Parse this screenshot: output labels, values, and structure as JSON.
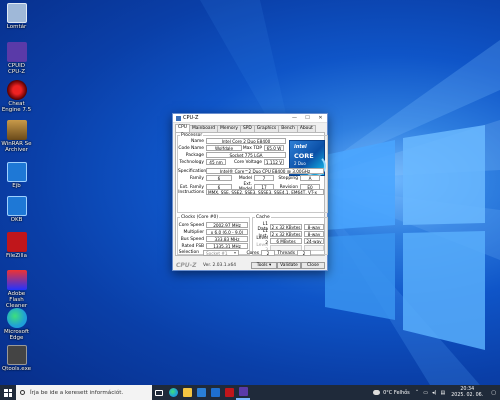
{
  "desktop": {
    "icons": [
      {
        "label": "Lomtár",
        "color": "#9fb8d8"
      },
      {
        "label": "CPUID CPU-Z",
        "color": "#5a3aa8"
      },
      {
        "label": "Cheat Engine 7.5",
        "color": "#c21b1b"
      },
      {
        "label": "WinRAR Se Archiver",
        "color": "#8a6b3a"
      },
      {
        "label": "Ejb",
        "color": "#1e78d6"
      },
      {
        "label": "OKB",
        "color": "#1e78d6"
      },
      {
        "label": "FileZilla",
        "color": "#c0161b"
      },
      {
        "label": "Adobe Flash Cleaner",
        "color": "#2a6fcf"
      },
      {
        "label": "Microsoft Edge",
        "color": "#1fa0d8"
      },
      {
        "label": "Qtools.exe",
        "color": "#444444"
      }
    ]
  },
  "window": {
    "title": "CPU-Z",
    "controls": {
      "minimize": "—",
      "maximize": "☐",
      "close": "✕"
    },
    "tabs": [
      "CPU",
      "Mainboard",
      "Memory",
      "SPD",
      "Graphics",
      "Bench",
      "About"
    ],
    "active_tab": "CPU",
    "processor": {
      "legend": "Processor",
      "name_label": "Name",
      "name": "Intel Core 2 Duo E8400",
      "codename_label": "Code Name",
      "codename": "Wolfdale",
      "maxtdp_label": "Max TDP",
      "maxtdp": "65.0 W",
      "package_label": "Package",
      "package": "Socket 775 LGA",
      "technology_label": "Technology",
      "technology": "45 nm",
      "corevoltage_label": "Core Voltage",
      "corevoltage": "1.112 V",
      "spec_label": "Specification",
      "spec": "Intel® Core™2 Duo CPU   E8400  @ 3.00GHz",
      "family_label": "Family",
      "family": "6",
      "model_label": "Model",
      "model": "7",
      "stepping_label": "Stepping",
      "stepping": "A",
      "extfamily_label": "Ext. Family",
      "extfamily": "6",
      "extmodel_label": "Ext. Model",
      "extmodel": "17",
      "revision_label": "Revision",
      "revision": "E0",
      "instructions_label": "Instructions",
      "instructions": "MMX, SSE, SSE2, SSE3, SSSE3, SSE4.1, EM64T, VT-x"
    },
    "intel_logo": {
      "brand": "intel",
      "line1": "CORE",
      "line2": "2 Duo",
      "line3": "inside"
    },
    "clocks": {
      "legend": "Clocks (Core #0)",
      "corespeed_label": "Core Speed",
      "corespeed": "2002.97 MHz",
      "multiplier_label": "Multiplier",
      "multiplier": "x 6.0 (6.0 - 9.0)",
      "busspeed_label": "Bus Speed",
      "busspeed": "333.83 MHz",
      "ratedfsb_label": "Rated FSB",
      "ratedfsb": "1335.31 MHz"
    },
    "cache": {
      "legend": "Cache",
      "l1data_label": "L1 Data",
      "l1data": "2 x 32 KBytes",
      "l1data_way": "8-way",
      "l1inst_label": "L1 Inst.",
      "l1inst": "2 x 32 KBytes",
      "l1inst_way": "8-way",
      "level2_label": "Level 2",
      "level2": "6 MBytes",
      "level2_way": "24-way",
      "level3_label": "Level 3"
    },
    "selection": {
      "label": "Selection",
      "value": "Socket #1",
      "cores_label": "Cores",
      "cores": "2",
      "threads_label": "Threads",
      "threads": "2"
    },
    "footer": {
      "brand": "CPU-Z",
      "version": "Ver. 2.03.1.x64",
      "tools": "Tools",
      "validate": "Validate",
      "close": "Close"
    }
  },
  "taskbar": {
    "search_placeholder": "Írja be ide a keresett információt.",
    "weather": "0°C  Felhős",
    "time": "20:34",
    "date": "2025. 02. 06."
  }
}
